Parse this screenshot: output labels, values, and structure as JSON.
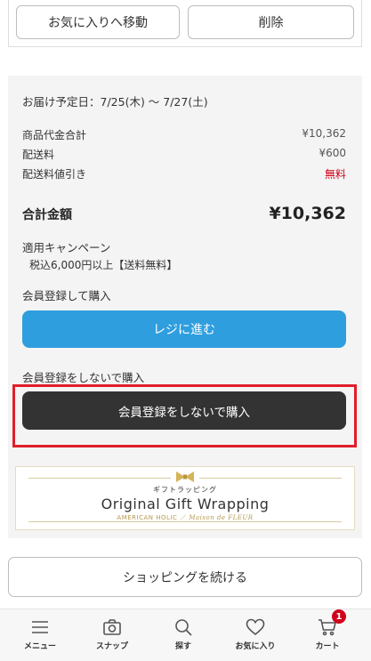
{
  "item_actions": {
    "move_to_favorites": "お気に入りへ移動",
    "delete": "削除"
  },
  "summary": {
    "delivery": "お届け予定日：7/25(木) ～ 7/27(土)",
    "rows": [
      {
        "label": "商品代金合計",
        "value": "¥10,362"
      },
      {
        "label": "配送料",
        "value": "¥600"
      },
      {
        "label": "配送料値引き",
        "value": "無料"
      }
    ],
    "total_label": "合計金額",
    "total_value": "¥10,362",
    "campaign_title": "適用キャンペーン",
    "campaign_detail": "税込6,000円以上【送料無料】",
    "register_label": "会員登録して購入",
    "register_button": "レジに進む",
    "guest_label": "会員登録をしないで購入",
    "guest_button": "会員登録をしないで購入"
  },
  "gift": {
    "kana": "ギフトラッピング",
    "title": "Original Gift Wrapping",
    "brand1": "AMERICAN HOLIC",
    "separator": "／",
    "brand2": "Maison de FLEUR"
  },
  "continue_button": "ショッピングを続ける",
  "tabbar": {
    "menu": "メニュー",
    "snap": "スナップ",
    "search": "探す",
    "favorites": "お気に入り",
    "cart": "カート",
    "cart_count": "1"
  },
  "colors": {
    "register_button": "#2f9ede",
    "guest_button": "#333333",
    "highlight": "#e01e2b",
    "free_text": "#d0021b",
    "badge": "#d0021b"
  }
}
